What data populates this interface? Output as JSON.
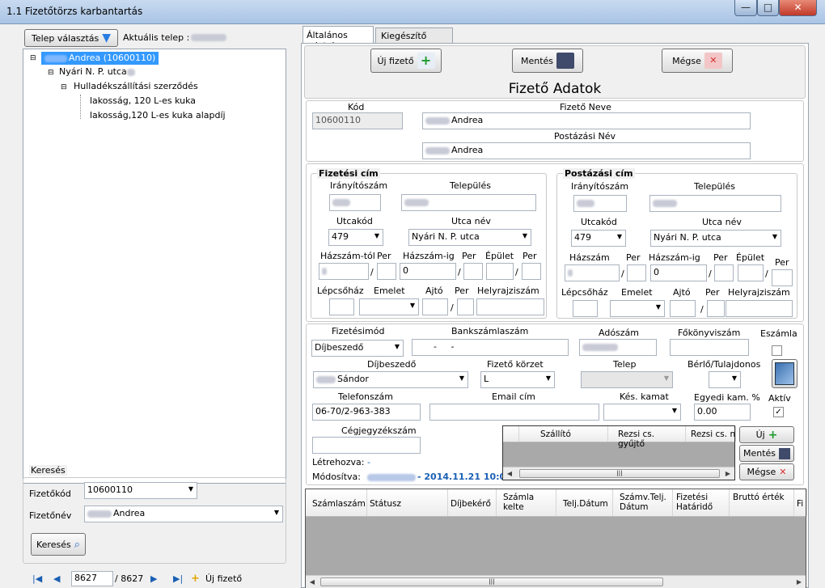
{
  "window": {
    "title": "1.1 Fizetőtörzs karbantartás",
    "min": "—",
    "max": "□",
    "close": "✕"
  },
  "left": {
    "telep_valasztas": "Telep választás",
    "aktualis_telep_label": "Aktuális telep :",
    "tree": {
      "root": "Andrea (10600110)",
      "street": "Nyári N. P. utca",
      "contract": "Hulladékszállítási szerződés",
      "items": [
        "lakosság, 120 L-es kuka",
        "lakosság,120 L-es kuka alapdíj"
      ]
    },
    "search": {
      "title": "Keresés",
      "fizetokod_label": "Fizetőkód",
      "fizetokod_value": "10600110",
      "fizetonev_label": "Fizetőnév",
      "fizetonev_value": "Andrea",
      "button": "Keresés"
    },
    "nav": {
      "current": "8627",
      "total": "/ 8627",
      "new": "Új fizető"
    }
  },
  "tabs": [
    "Általános adatok",
    "Kiegészítő adatok"
  ],
  "toolbar": {
    "new": "Új fizető",
    "save": "Mentés",
    "cancel": "Mégse"
  },
  "form": {
    "title": "Fizető Adatok",
    "kod_label": "Kód",
    "kod_value": "10600110",
    "fizeto_neve_label": "Fizető Neve",
    "fizeto_neve_value": "Andrea",
    "postazasi_nev_label": "Postázási Név",
    "postazasi_nev_value": "Andrea"
  },
  "fizetesi_cim": {
    "title": "Fizetési cím",
    "iranyitoszam": "Irányítószám",
    "telepules": "Település",
    "utcakod": "Utcakód",
    "utcakod_value": "479",
    "utca_nev": "Utca név",
    "utca_nev_value": "Nyári N. P. utca",
    "hazszam_tol": "Házszám-tól",
    "per": "Per",
    "hazszam_ig": "Házszám-ig",
    "hazszam_ig_value": "0",
    "epulet": "Épület",
    "lepcsohaz": "Lépcsőház",
    "emelet": "Emelet",
    "ajto": "Ajtó",
    "helyrajziszam": "Helyrajziszám"
  },
  "postazasi_cim": {
    "title": "Postázási cím",
    "iranyitoszam": "Irányítószám",
    "telepules": "Település",
    "utcakod": "Utcakód",
    "utcakod_value": "479",
    "utca_nev": "Utca név",
    "utca_nev_value": "Nyári N. P. utca",
    "hazszam": "Házszám",
    "per": "Per",
    "hazszam_ig": "Házszám-ig",
    "hazszam_ig_value": "0",
    "epulet": "Épület",
    "lepcsohaz": "Lépcsőház",
    "emelet": "Emelet",
    "ajto": "Ajtó",
    "helyrajziszam": "Helyrajziszám"
  },
  "payment": {
    "fizetesimod": "Fizetésimód",
    "fizetesimod_value": "Díjbeszedő",
    "bankszamlaszam": "Bankszámlaszám",
    "bankszamlaszam_value": "-     -",
    "adoszam": "Adószám",
    "fokonyviszam": "Főkönyviszám",
    "eszamla": "Eszámla",
    "dijbeszedo": "Díjbeszedő",
    "dijbeszedo_value": "Sándor",
    "fizeto_korzet": "Fizető körzet",
    "fizeto_korzet_value": "L",
    "telep": "Telep",
    "berlo": "Bérlő/Tulajdonos",
    "telefonszam": "Telefonszám",
    "telefonszam_value": "06-70/2-963-383",
    "email": "Email cím",
    "kes_kamat": "Kés. kamat",
    "egyedi_kam": "Egyedi kam. %",
    "egyedi_kam_value": "0.00",
    "aktiv": "Aktív",
    "cegjegyzekszam": "Cégjegyzékszám",
    "letrehozva": "Létrehozva:",
    "letrehozva_value": "-",
    "modositva": "Módosítva:",
    "modositva_value": "- 2014.11.21 10:0"
  },
  "subgrid": {
    "columns": [
      "Szállító",
      "Rezsi cs. gyűjtő",
      "Rezsi cs. n"
    ]
  },
  "side_buttons": {
    "new": "Új",
    "save": "Mentés",
    "cancel": "Mégse"
  },
  "invoice_grid": {
    "columns": [
      "Számlaszám",
      "Státusz",
      "Díjbekérő",
      "Számla kelte",
      "Telj.Dátum",
      "Számv.Telj. Dátum",
      "Fizetési Határidő",
      "Bruttó érték",
      "Fi"
    ]
  },
  "colors": {
    "accent": "#3399ff",
    "blue_text": "#1a5fb4"
  }
}
